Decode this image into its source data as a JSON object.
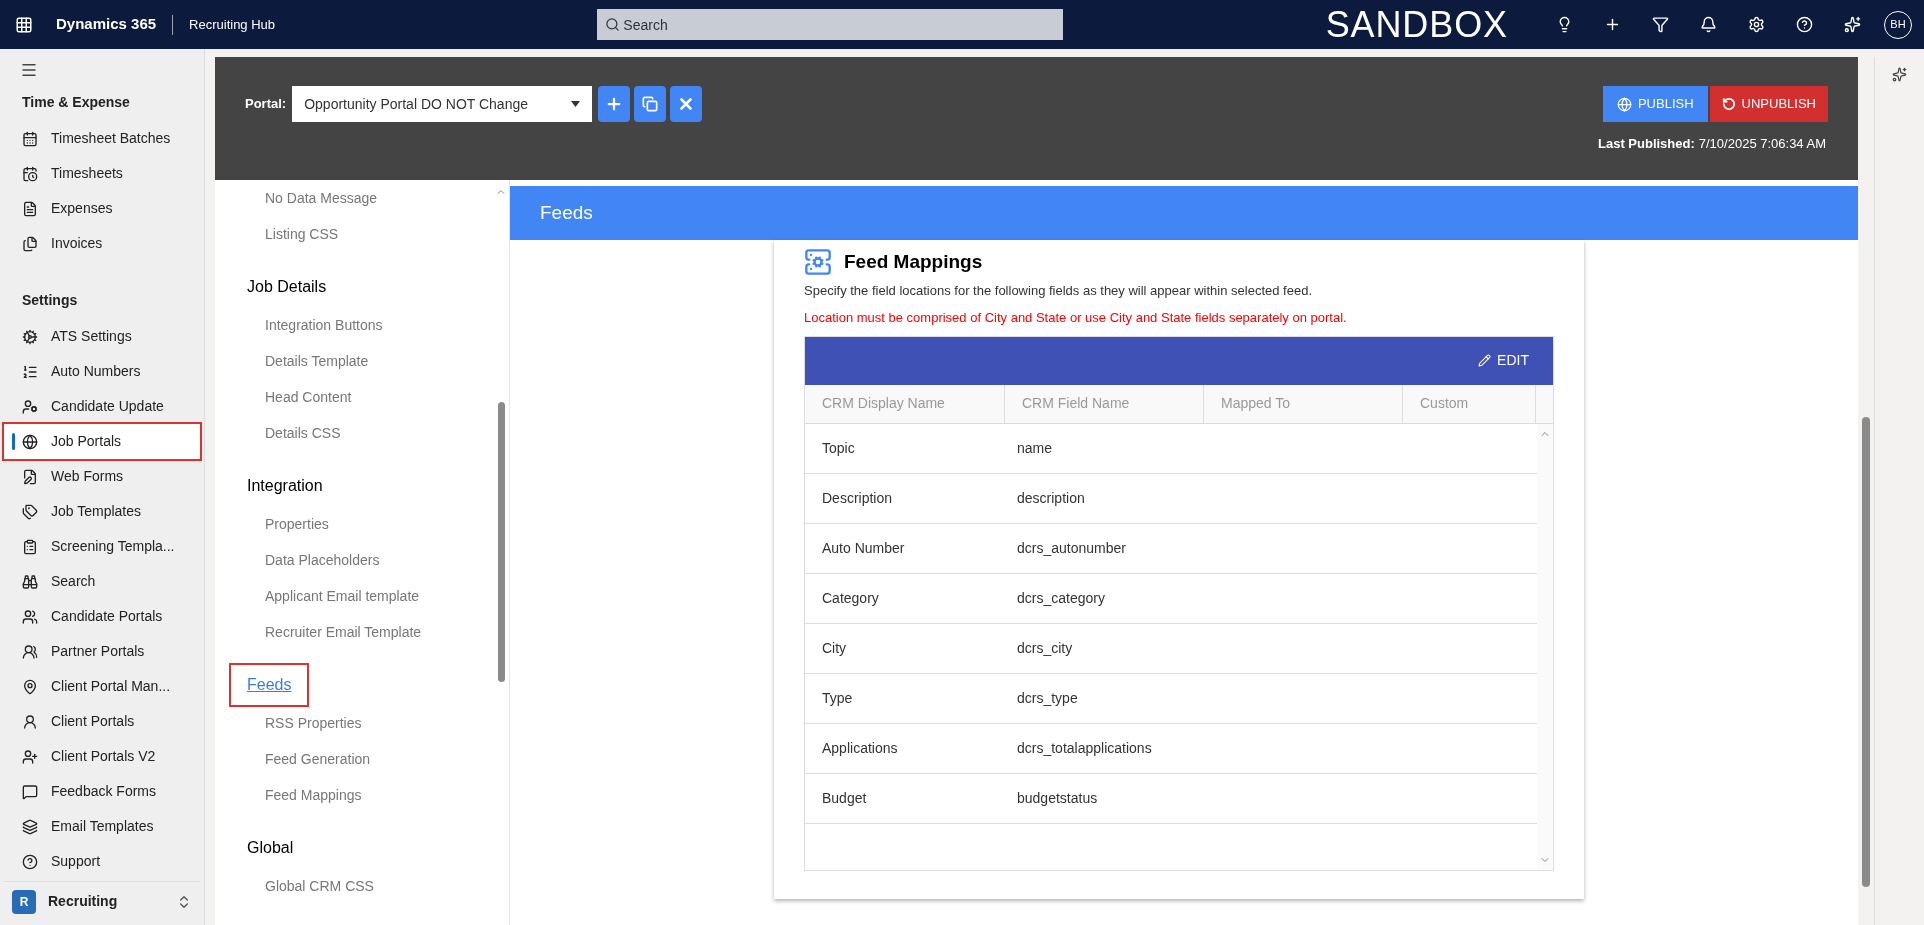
{
  "top_bar": {
    "app_name": "Dynamics 365",
    "area": "Recruiting Hub",
    "search": {
      "placeholder": "Search"
    },
    "environment": "SANDBOX",
    "avatar": "BH"
  },
  "sidebar": {
    "groups": [
      {
        "title": "Time & Expense",
        "items": [
          {
            "label": "Timesheet Batches",
            "selected": false
          },
          {
            "label": "Timesheets",
            "selected": false
          },
          {
            "label": "Expenses",
            "selected": false
          },
          {
            "label": "Invoices",
            "selected": false
          }
        ]
      },
      {
        "title": "Settings",
        "items": [
          {
            "label": "ATS Settings",
            "selected": false
          },
          {
            "label": "Auto Numbers",
            "selected": false
          },
          {
            "label": "Candidate Update",
            "selected": false
          },
          {
            "label": "Job Portals",
            "selected": true
          },
          {
            "label": "Web Forms",
            "selected": false
          },
          {
            "label": "Job Templates",
            "selected": false
          },
          {
            "label": "Screening Templa...",
            "selected": false
          },
          {
            "label": "Search",
            "selected": false
          },
          {
            "label": "Candidate Portals",
            "selected": false
          },
          {
            "label": "Partner Portals",
            "selected": false
          },
          {
            "label": "Client Portal Man...",
            "selected": false
          },
          {
            "label": "Client Portals",
            "selected": false
          },
          {
            "label": "Client Portals V2",
            "selected": false
          },
          {
            "label": "Feedback Forms",
            "selected": false
          },
          {
            "label": "Email Templates",
            "selected": false
          },
          {
            "label": "Support",
            "selected": false
          }
        ]
      }
    ],
    "area_switcher": {
      "badge": "R",
      "label": "Recruiting"
    }
  },
  "portal_bar": {
    "label": "Portal:",
    "portal": "Opportunity Portal DO NOT Change",
    "publish": "PUBLISH",
    "unpublish": "UNPUBLISH",
    "last_published_label": "Last Published:",
    "last_published": "7/10/2025 7:06:34 AM"
  },
  "nav": {
    "sections": [
      {
        "items": [
          "No Data Message",
          "Listing CSS"
        ]
      },
      {
        "title": "Job Details",
        "selected": false,
        "items": [
          "Integration Buttons",
          "Details Template",
          "Head Content",
          "Details CSS"
        ]
      },
      {
        "title": "Integration",
        "selected": false,
        "items": [
          "Properties",
          "Data Placeholders",
          "Applicant Email template",
          "Recruiter Email Template"
        ]
      },
      {
        "title": "Feeds",
        "selected": true,
        "items": [
          "RSS Properties",
          "Feed Generation",
          "Feed Mappings"
        ]
      },
      {
        "title": "Global",
        "selected": false,
        "items": [
          "Global CRM CSS"
        ]
      }
    ]
  },
  "page_header": "Feeds",
  "feed_mappings": {
    "title": "Feed Mappings",
    "description": "Specify the field locations for the following fields as they will appear within selected feed.",
    "warning": "Location must be comprised of City and State or use City and State fields separately on portal.",
    "edit": "EDIT",
    "columns": [
      "CRM Display Name",
      "CRM Field Name",
      "Mapped To",
      "Custom"
    ],
    "rows": [
      {
        "display_name": "Topic",
        "field_name": "name"
      },
      {
        "display_name": "Description",
        "field_name": "description"
      },
      {
        "display_name": "Auto Number",
        "field_name": "dcrs_autonumber"
      },
      {
        "display_name": "Category",
        "field_name": "dcrs_category"
      },
      {
        "display_name": "City",
        "field_name": "dcrs_city"
      },
      {
        "display_name": "Type",
        "field_name": "dcrs_type"
      },
      {
        "display_name": "Applications",
        "field_name": "dcrs_totalapplications"
      },
      {
        "display_name": "Budget",
        "field_name": "budgetstatus"
      }
    ]
  }
}
